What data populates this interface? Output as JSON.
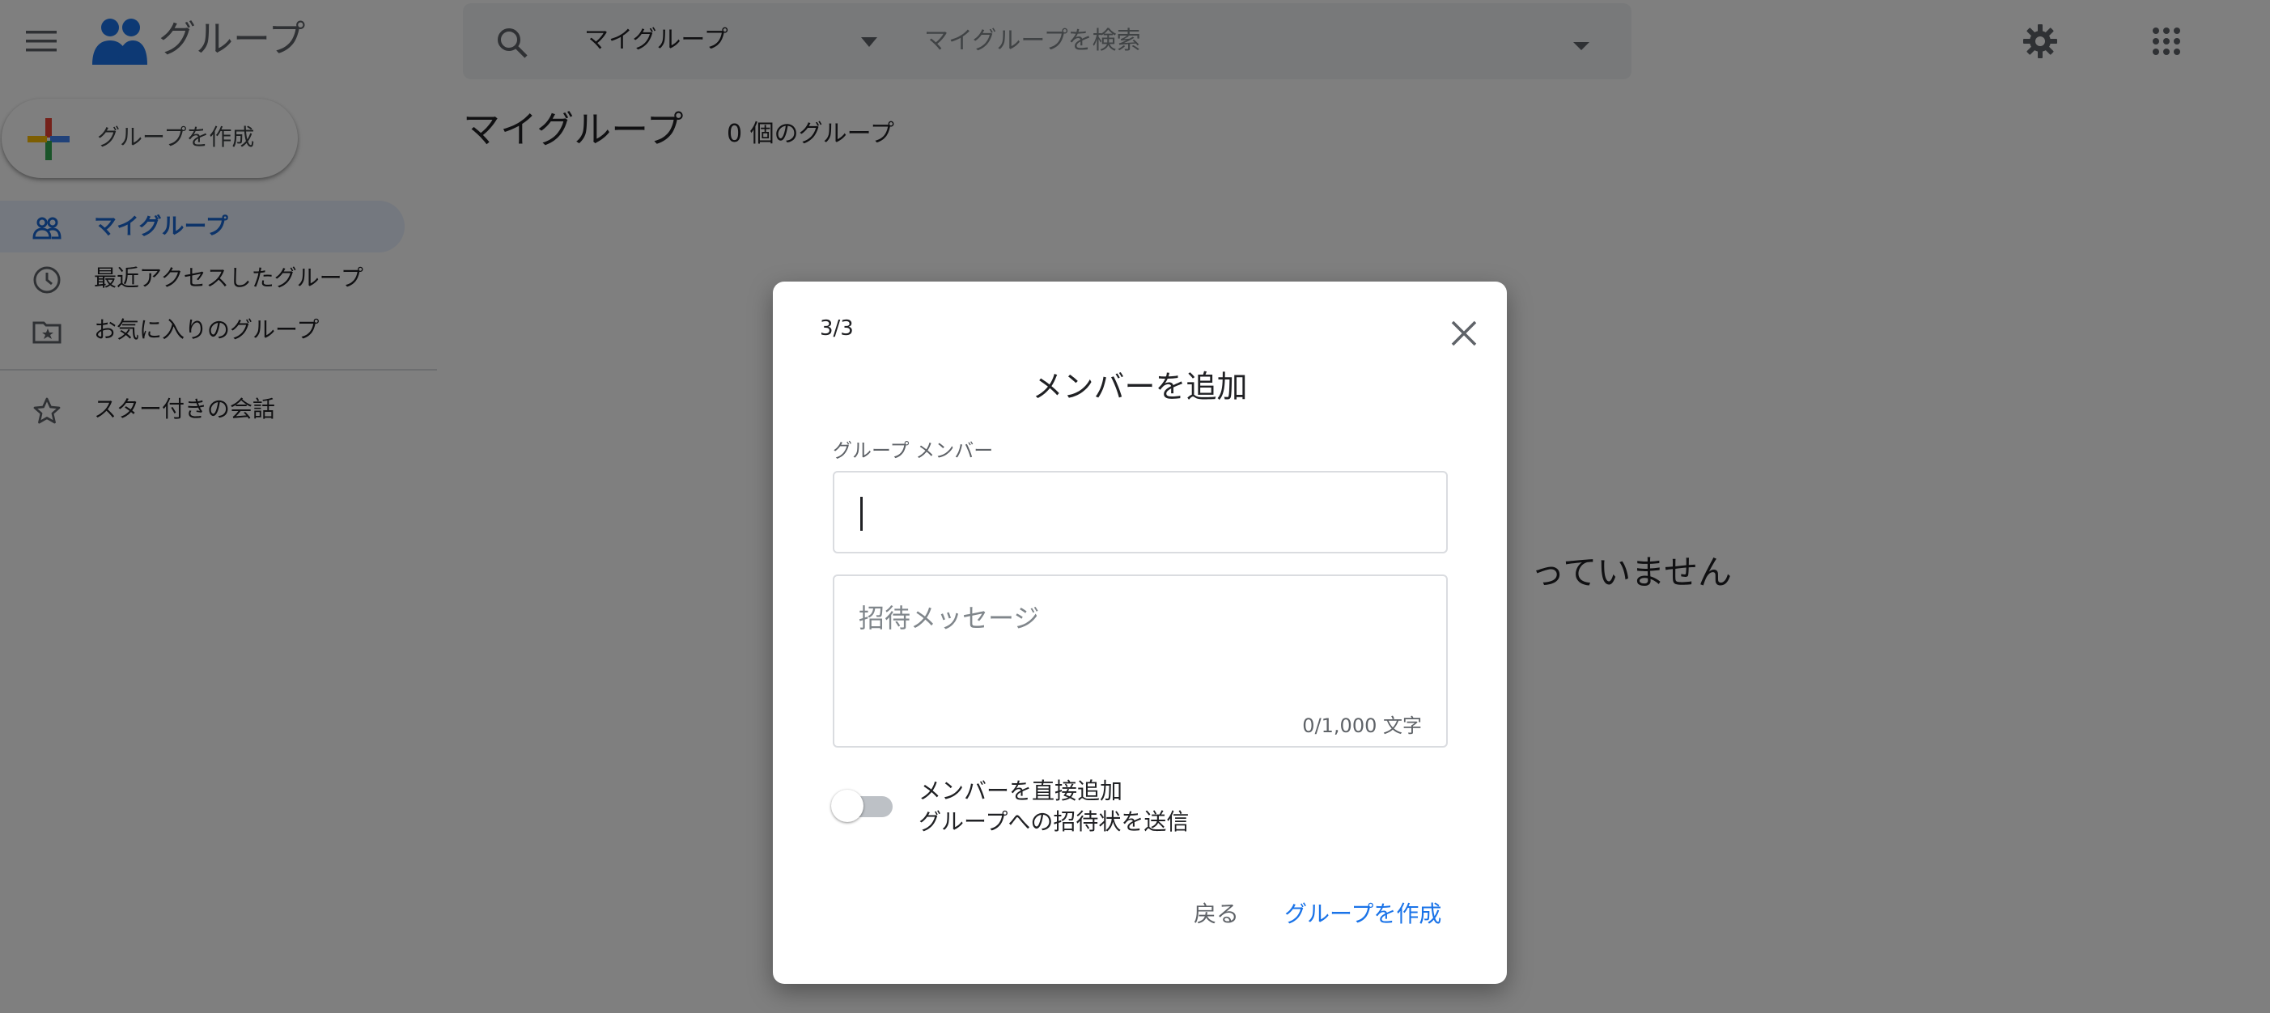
{
  "header": {
    "app_title": "グループ",
    "search": {
      "scope": "マイグループ",
      "placeholder": "マイグループを検索"
    }
  },
  "sidebar": {
    "create_label": "グループを作成",
    "items": [
      {
        "label": "マイグループ",
        "icon": "people-icon",
        "active": true
      },
      {
        "label": "最近アクセスしたグループ",
        "icon": "clock-icon",
        "active": false
      },
      {
        "label": "お気に入りのグループ",
        "icon": "folder-star-icon",
        "active": false
      },
      {
        "label": "スター付きの会話",
        "icon": "star-icon",
        "active": false
      }
    ]
  },
  "main": {
    "page_title": "マイグループ",
    "group_count": "0 個のグループ",
    "empty_message": "っていません"
  },
  "dialog": {
    "step": "3/3",
    "title": "メンバーを追加",
    "members_label": "グループ メンバー",
    "members_value": "",
    "message_placeholder": "招待メッセージ",
    "char_count": "0/1,000 文字",
    "toggle_title": "メンバーを直接追加",
    "toggle_subtitle": "グループへの招待状を送信",
    "toggle_on": false,
    "back_label": "戻る",
    "create_label": "グループを作成"
  },
  "colors": {
    "accent": "#1a73e8",
    "active_nav_bg": "#e8f0fe",
    "active_nav_text": "#1967d2",
    "scrim": "rgba(0,0,0,0.5)"
  }
}
